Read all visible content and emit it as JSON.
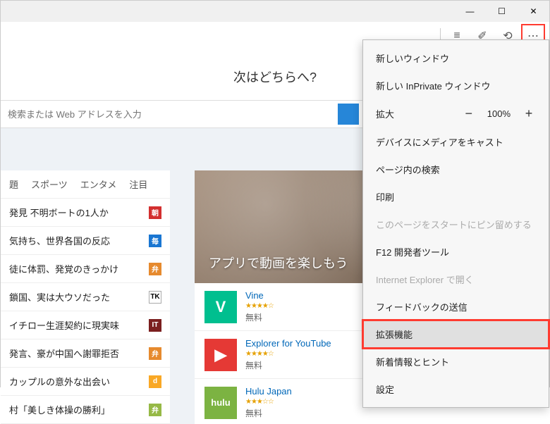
{
  "titlebar": {
    "min": "—",
    "max": "☐",
    "close": "✕"
  },
  "toolbar": {
    "hub_icon": "≡",
    "note_icon": "✐",
    "share_icon": "⟲",
    "more_icon": "⋯"
  },
  "heading": "次はどちらへ?",
  "search": {
    "placeholder": "検索または Web アドレスを入力"
  },
  "tabs": [
    "題",
    "スポーツ",
    "エンタメ",
    "注目"
  ],
  "news": [
    {
      "text": "発見 不明ボートの1人か",
      "badge": "朝",
      "cls": "b-red"
    },
    {
      "text": "気持ち、世界各国の反応",
      "badge": "毎",
      "cls": "b-blue"
    },
    {
      "text": "徒に体罰、発覚のきっかけ",
      "badge": "弁",
      "cls": "b-orange"
    },
    {
      "text": "鎖国、実は大ウソだった",
      "badge": "TK",
      "cls": "b-white"
    },
    {
      "text": "イチロー生涯契約に現実味",
      "badge": "IT",
      "cls": "b-darkred"
    },
    {
      "text": "発言、豪が中国へ謝罪拒否",
      "badge": "弁",
      "cls": "b-orange"
    },
    {
      "text": "カップルの意外な出会い",
      "badge": "d",
      "cls": "b-yellow"
    },
    {
      "text": "村「美しき体操の勝利」",
      "badge": "弁",
      "cls": "b-green"
    }
  ],
  "hero": {
    "title": "アプリで動画を楽しもう"
  },
  "apps": [
    {
      "name": "Vine",
      "price": "無料",
      "icon": "V",
      "cls": "vine",
      "stars": "★★★★☆"
    },
    {
      "name": "Explorer for YouTube",
      "price": "無料",
      "icon": "▶",
      "cls": "eyt",
      "stars": "★★★★☆"
    },
    {
      "name": "Hulu Japan",
      "price": "無料",
      "icon": "hulu",
      "cls": "hulu",
      "stars": "★★★☆☆"
    }
  ],
  "menu": {
    "new_window": "新しいウィンドウ",
    "new_inprivate": "新しい InPrivate ウィンドウ",
    "zoom_label": "拡大",
    "zoom_value": "100%",
    "cast": "デバイスにメディアをキャスト",
    "find": "ページ内の検索",
    "print": "印刷",
    "pin_start": "このページをスタートにピン留めする",
    "devtools": "F12 開発者ツール",
    "open_ie": "Internet Explorer で開く",
    "feedback": "フィードバックの送信",
    "extensions": "拡張機能",
    "whatsnew": "新着情報とヒント",
    "settings": "設定"
  }
}
